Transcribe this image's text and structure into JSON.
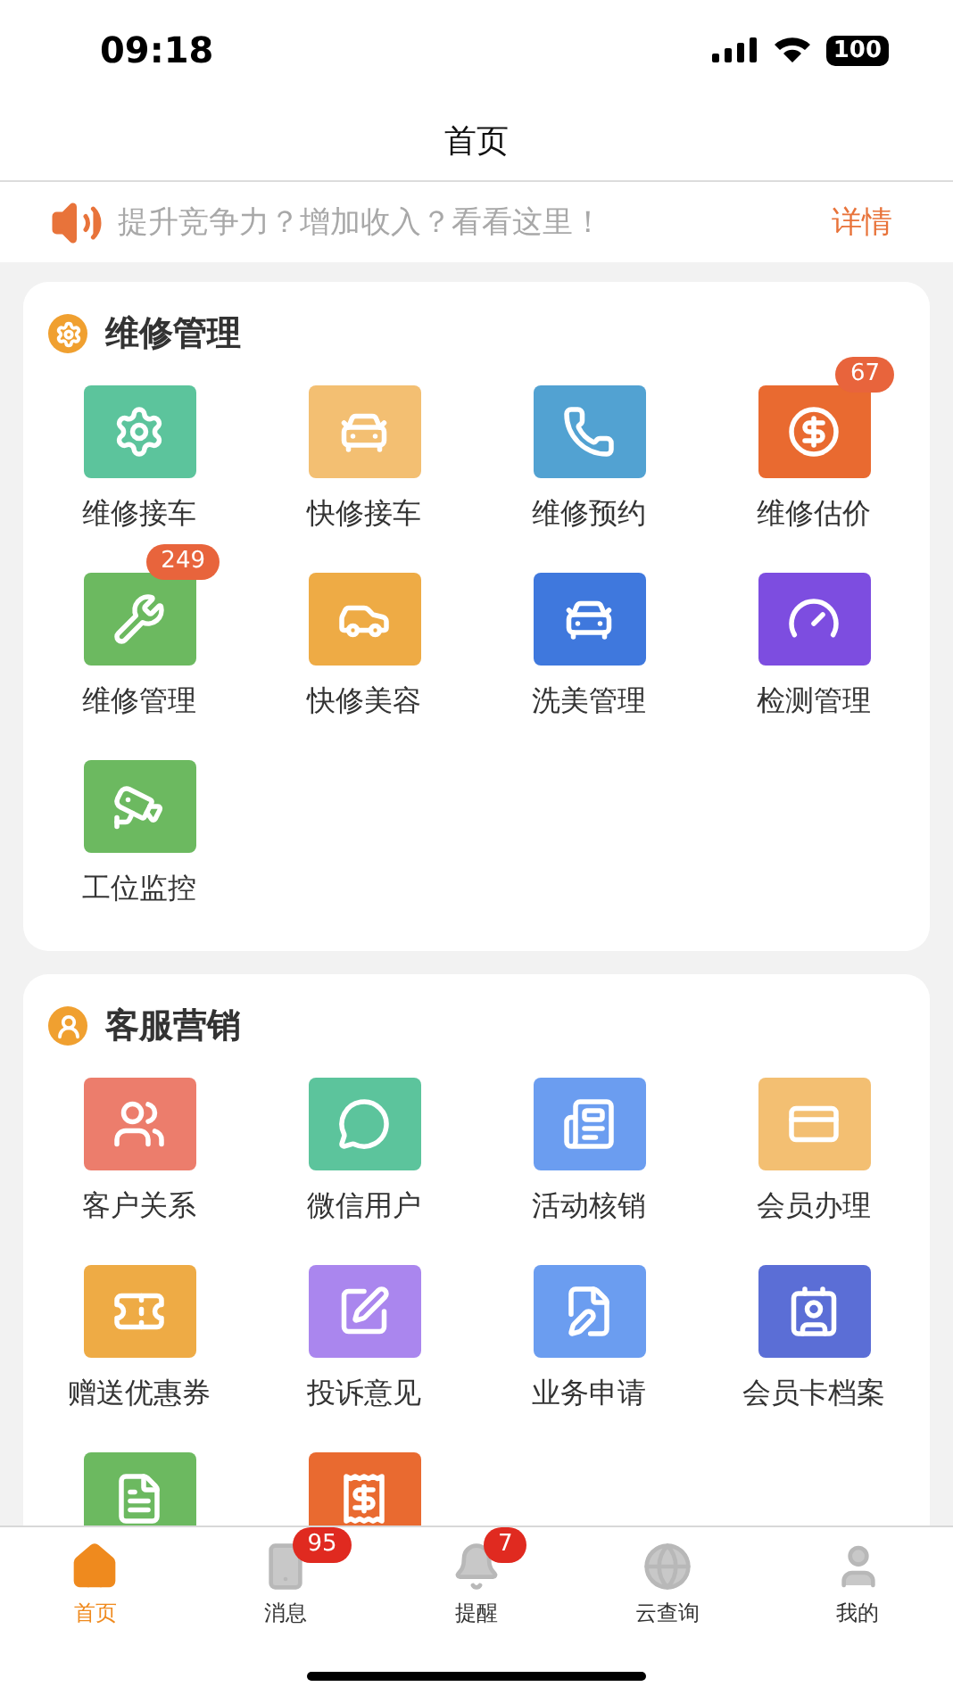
{
  "status_bar": {
    "time": "09:18",
    "battery": "100"
  },
  "nav_bar": {
    "title": "首页"
  },
  "notice": {
    "text": "提升竞争力？增加收入？看看这里！",
    "link": "详情"
  },
  "sections": [
    {
      "title": "维修管理",
      "items": [
        {
          "label": "维修接车",
          "color": "#5cc49c"
        },
        {
          "label": "快修接车",
          "color": "#f3bf72"
        },
        {
          "label": "维修预约",
          "color": "#52a2d2"
        },
        {
          "label": "维修估价",
          "color": "#e96a30",
          "badge": "67"
        },
        {
          "label": "维修管理",
          "color": "#6cb960",
          "badge": "249"
        },
        {
          "label": "快修美容",
          "color": "#eeab45"
        },
        {
          "label": "洗美管理",
          "color": "#3f78dd"
        },
        {
          "label": "检测管理",
          "color": "#7d4de0"
        },
        {
          "label": "工位监控",
          "color": "#6cb960"
        }
      ]
    },
    {
      "title": "客服营销",
      "items": [
        {
          "label": "客户关系",
          "color": "#ec7d6c"
        },
        {
          "label": "微信用户",
          "color": "#5cc49c"
        },
        {
          "label": "活动核销",
          "color": "#6b9df0"
        },
        {
          "label": "会员办理",
          "color": "#f3bf72"
        },
        {
          "label": "赠送优惠券",
          "color": "#eeab45"
        },
        {
          "label": "投诉意见",
          "color": "#aa86ee"
        },
        {
          "label": "业务申请",
          "color": "#6b9df0"
        },
        {
          "label": "会员卡档案",
          "color": "#5b6ed6"
        },
        {
          "color": "#6cb960"
        },
        {
          "color": "#e96a30"
        }
      ]
    }
  ],
  "tab_bar": [
    {
      "label": "首页",
      "selected": true
    },
    {
      "label": "消息",
      "selected": false,
      "badge": "95"
    },
    {
      "label": "提醒",
      "selected": false,
      "badge": "7"
    },
    {
      "label": "云查询",
      "selected": false
    },
    {
      "label": "我的",
      "selected": false
    }
  ]
}
